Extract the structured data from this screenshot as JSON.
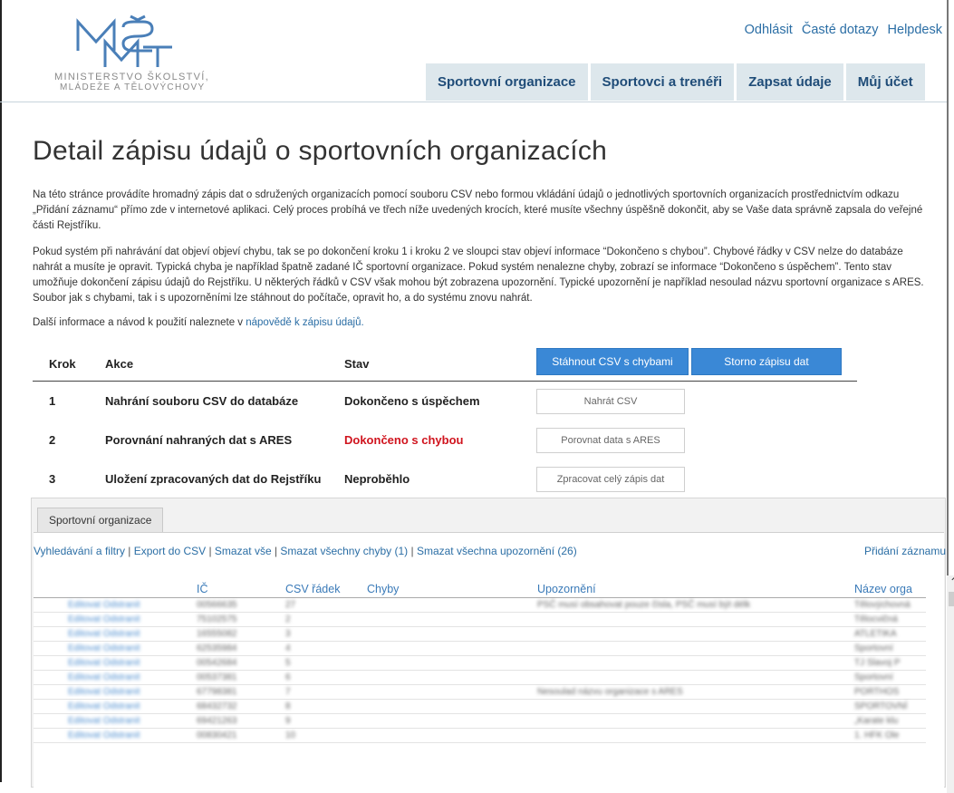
{
  "logo": {
    "line1": "Ministerstvo školství,",
    "line2": "mládeže a tělovýchovy"
  },
  "toplinks": [
    "Odhlásit",
    "Časté dotazy",
    "Helpdesk"
  ],
  "nav": [
    "Sportovní organizace",
    "Sportovci a trenéři",
    "Zapsat údaje",
    "Můj účet"
  ],
  "title": "Detail zápisu údajů o sportovních organizacích",
  "para1": "Na této stránce provádíte hromadný zápis dat o sdružených organizacích pomocí souboru CSV nebo formou vkládání údajů o jednotlivých sportovních organizacích prostřednictvím odkazu „Přidání záznamu“ přímo zde v internetové aplikaci. Celý proces probíhá ve třech níže uvedených krocích, které musíte všechny úspěšně dokončit, aby se Vaše data správně zapsala do veřejné části Rejstříku.",
  "para2": "Pokud systém při nahrávání dat objeví objeví chybu, tak se po dokončení kroku 1 i kroku 2 ve sloupci stav objeví informace “Dokončeno s chybou”. Chybové řádky v CSV nelze do databáze nahrát a musíte je opravit. Typická chyba je například špatně zadané IČ sportovní organizace. Pokud systém nenalezne chyby, zobrazí se informace “Dokončeno s úspěchem”. Tento stav umožňuje dokončení zápisu údajů do Rejstříku. U některých řádků v CSV však mohou být zobrazena upozornění. Typické upozornění je například nesoulad názvu sportovní organizace s ARES. Soubor jak s chybami, tak i s upozorněními lze stáhnout do počítače, opravit ho, a do systému znovu nahrát.",
  "para3_prefix": "Další informace a návod k použití naleznete v ",
  "para3_link": "nápovědě k zápisu údajů.",
  "steps": {
    "headers": {
      "krok": "Krok",
      "akce": "Akce",
      "stav": "Stav"
    },
    "btn_download": "Stáhnout CSV s chybami",
    "btn_cancel": "Storno zápisu dat",
    "rows": [
      {
        "n": "1",
        "akce": "Nahrání souboru CSV do databáze",
        "stav": "Dokončeno s úspěchem",
        "btn": "Nahrát CSV"
      },
      {
        "n": "2",
        "akce": "Porovnání nahraných dat s ARES",
        "stav": "Dokončeno s chybou",
        "btn": "Porovnat data s ARES"
      },
      {
        "n": "3",
        "akce": "Uložení zpracovaných dat do Rejstříku",
        "stav": "Neproběhlo",
        "btn": "Zpracovat celý zápis dat"
      }
    ]
  },
  "panel": {
    "tab": "Sportovní organizace",
    "links": [
      "Vyhledávání a filtry",
      "Export do CSV",
      "Smazat vše",
      "Smazat všechny chyby (1)",
      "Smazat všechna upozornění (26)"
    ],
    "add": "Přidání záznamu",
    "cols": [
      "IČ",
      "CSV řádek",
      "Chyby",
      "Upozornění",
      "Název orga"
    ]
  },
  "rows": [
    {
      "action": "Editovat Odstranit",
      "ic": "00566635",
      "csv": "27",
      "warn": "PSČ musí obsahovat pouze čísla, PSČ musí být délk",
      "name": "Tělovýchovná"
    },
    {
      "action": "Editovat Odstranit",
      "ic": "75102575",
      "csv": "2",
      "warn": "",
      "name": "Tělocvičná"
    },
    {
      "action": "Editovat Odstranit",
      "ic": "16555082",
      "csv": "3",
      "warn": "",
      "name": "ATLETIKA"
    },
    {
      "action": "Editovat Odstranit",
      "ic": "62535984",
      "csv": "4",
      "warn": "",
      "name": "Sportovní"
    },
    {
      "action": "Editovat Odstranit",
      "ic": "00542684",
      "csv": "5",
      "warn": "",
      "name": "TJ Slavoj P"
    },
    {
      "action": "Editovat Odstranit",
      "ic": "00537381",
      "csv": "6",
      "warn": "",
      "name": "Sportovní"
    },
    {
      "action": "Editovat Odstranit",
      "ic": "67798381",
      "csv": "7",
      "warn": "Nesoulad názvu organizace s ARES",
      "name": "PORTHOS"
    },
    {
      "action": "Editovat Odstranit",
      "ic": "68432732",
      "csv": "8",
      "warn": "",
      "name": "SPORTOVNÍ"
    },
    {
      "action": "Editovat Odstranit",
      "ic": "69421263",
      "csv": "9",
      "warn": "",
      "name": "„Karate klu"
    },
    {
      "action": "Editovat Odstranit",
      "ic": "00830421",
      "csv": "10",
      "warn": "",
      "name": "1. HFK Ole"
    }
  ]
}
